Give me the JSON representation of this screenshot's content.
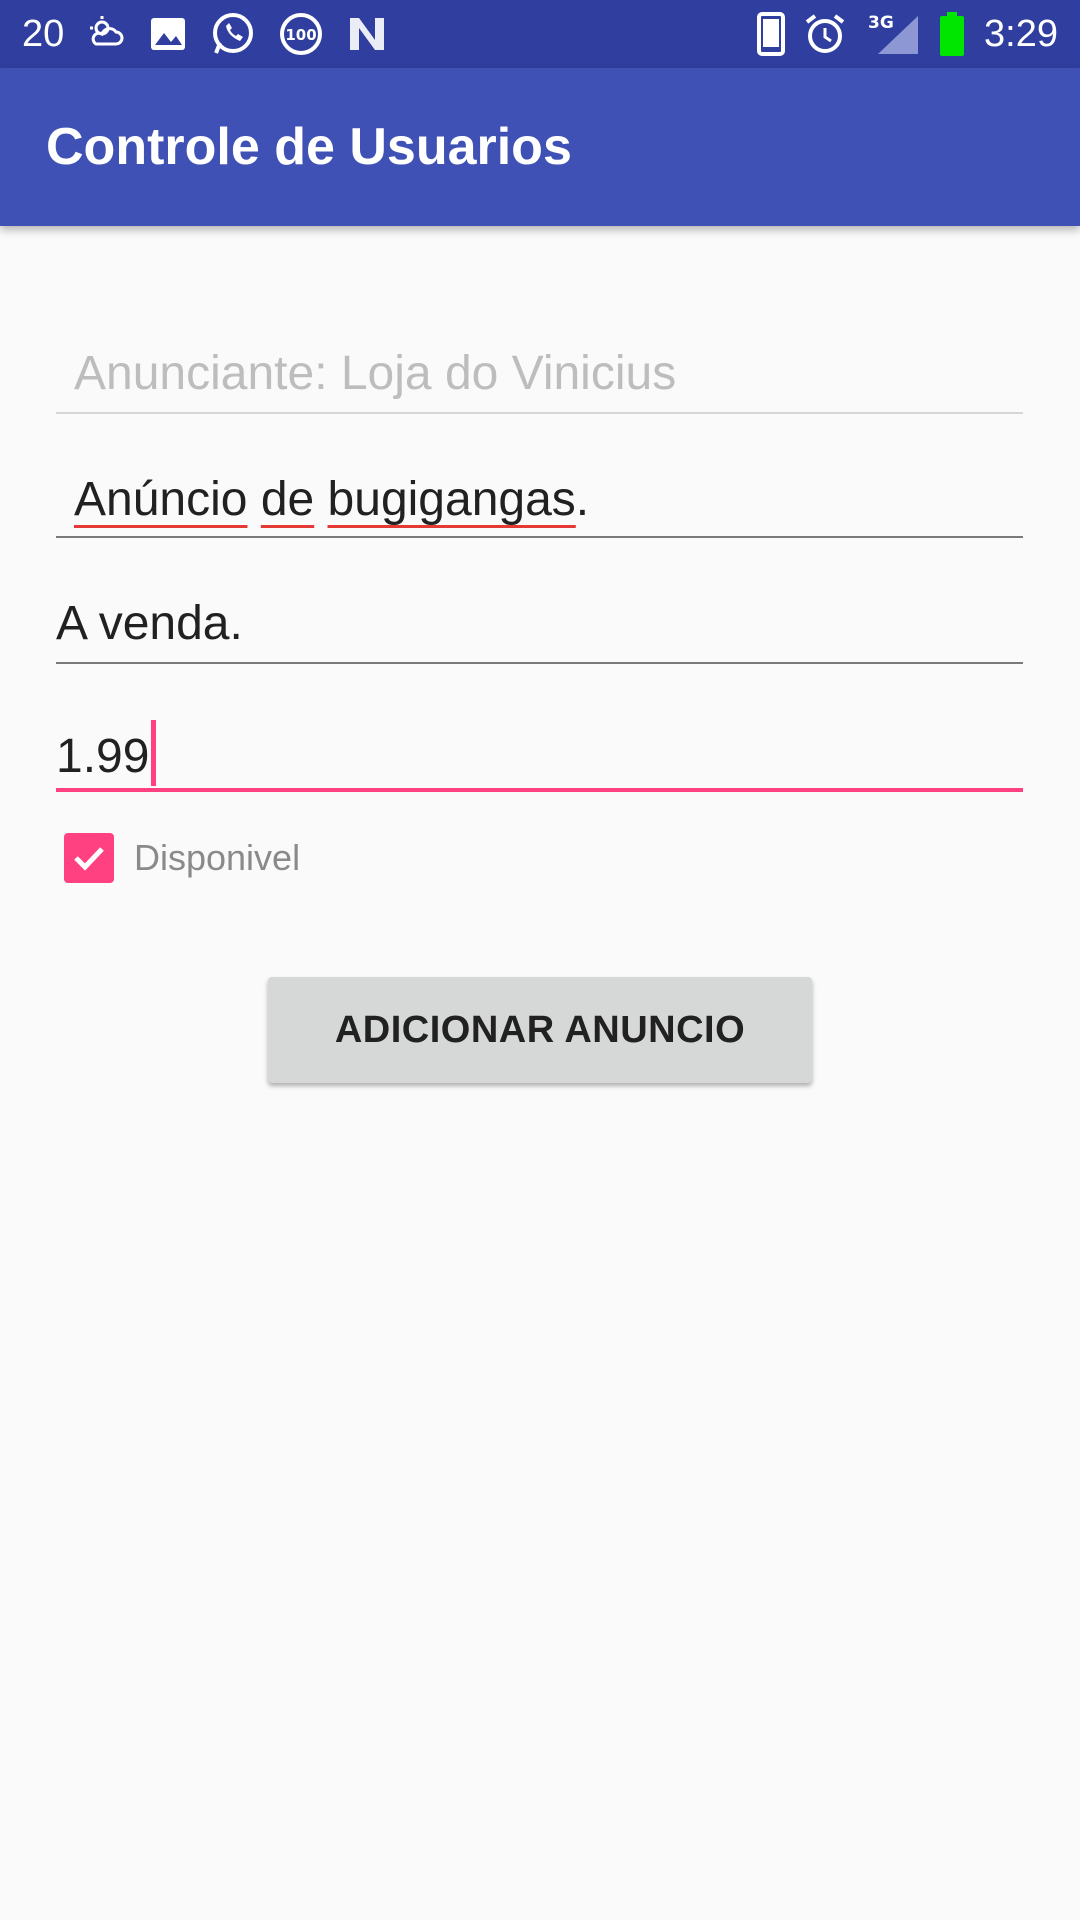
{
  "status_bar": {
    "notification_count": "20",
    "time": "3:29",
    "network_label": "3G",
    "badge_100": "100",
    "icons": [
      "weather-icon",
      "image-icon",
      "whatsapp-icon",
      "badge-100-icon",
      "n-logo-icon",
      "phone-icon",
      "alarm-icon",
      "signal-icon",
      "battery-icon"
    ]
  },
  "app_bar": {
    "title": "Controle de Usuarios"
  },
  "form": {
    "advertiser_placeholder": "Anunciante: Loja do Vinicius",
    "title_words": [
      "Anúncio",
      "de",
      "bugigangas"
    ],
    "title_punct": ".",
    "description_value": "A venda.",
    "price_value": "1.99",
    "available_label": "Disponivel",
    "available_checked": true
  },
  "actions": {
    "add_button_label": "ADICIONAR ANUNCIO"
  },
  "colors": {
    "status_bar": "#303f9f",
    "app_bar": "#3f51b5",
    "accent": "#ff4081",
    "battery": "#00e600"
  }
}
